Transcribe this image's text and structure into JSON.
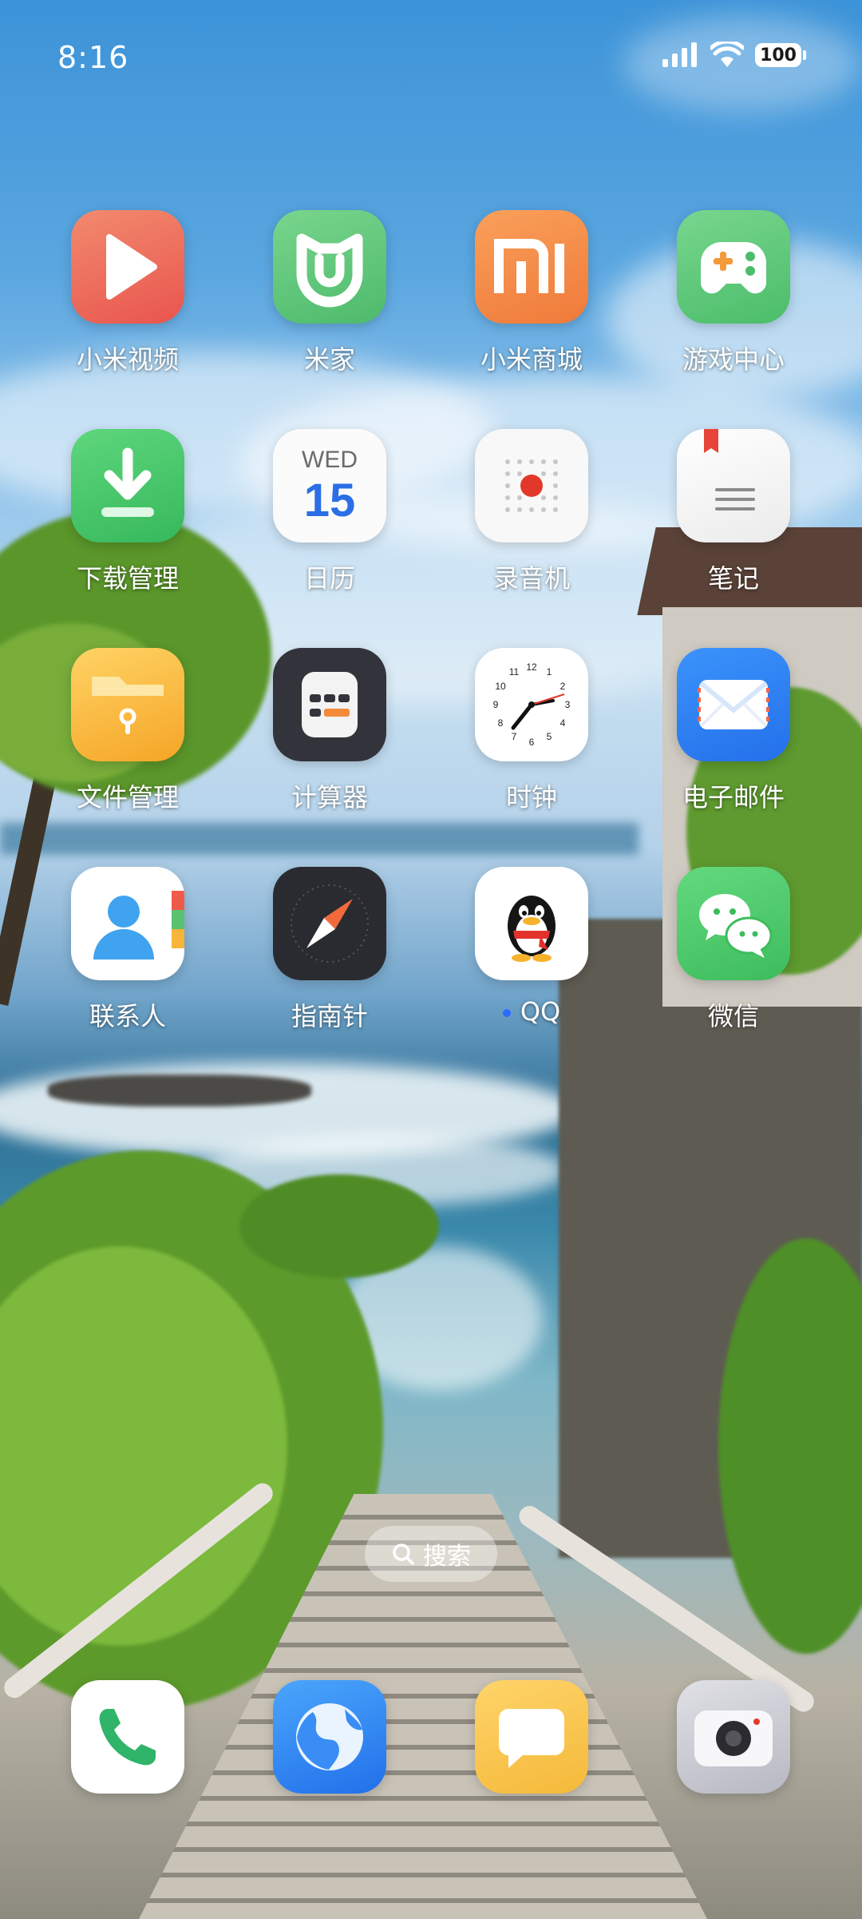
{
  "status_bar": {
    "time": "8:16",
    "battery": "100",
    "icons": [
      "signal-icon",
      "wifi-icon",
      "battery-icon"
    ]
  },
  "apps": [
    {
      "label": "小米视频",
      "icon": "play-icon"
    },
    {
      "label": "米家",
      "icon": "mijia-icon"
    },
    {
      "label": "小米商城",
      "icon": "mi-store-icon"
    },
    {
      "label": "游戏中心",
      "icon": "gamepad-icon"
    },
    {
      "label": "下载管理",
      "icon": "download-icon"
    },
    {
      "label": "日历",
      "icon": "calendar-icon",
      "day": "WED",
      "date": "15"
    },
    {
      "label": "录音机",
      "icon": "recorder-icon"
    },
    {
      "label": "笔记",
      "icon": "notes-icon"
    },
    {
      "label": "文件管理",
      "icon": "folder-icon"
    },
    {
      "label": "计算器",
      "icon": "calculator-icon"
    },
    {
      "label": "时钟",
      "icon": "clock-icon"
    },
    {
      "label": "电子邮件",
      "icon": "mail-icon"
    },
    {
      "label": "联系人",
      "icon": "contacts-icon"
    },
    {
      "label": "指南针",
      "icon": "compass-icon"
    },
    {
      "label": "QQ",
      "icon": "qq-penguin-icon",
      "new_install_dot": true
    },
    {
      "label": "微信",
      "icon": "wechat-icon"
    }
  ],
  "search": {
    "label": "搜索",
    "icon": "search-icon"
  },
  "dock": [
    {
      "name": "phone",
      "icon": "phone-icon"
    },
    {
      "name": "browser",
      "icon": "browser-icon"
    },
    {
      "name": "messages",
      "icon": "message-icon"
    },
    {
      "name": "camera",
      "icon": "camera-icon"
    }
  ],
  "colors": {
    "video": "#ef6a5c",
    "mijia": "#5ec77a",
    "store": "#f58a4a",
    "game": "#5cc97a",
    "download": "#4cc86a",
    "calendar_date": "#2b6ee6",
    "recorder_dot": "#e2382b",
    "folder": "#f7b53a",
    "calculator": "#33343b",
    "mail": "#2f86f5",
    "compass": "#2a2b30",
    "wechat": "#4cc86a",
    "phone": "#2fb46a",
    "browser": "#2f7ff0",
    "messages": "#f5c24a",
    "camera": "#c9c9d0"
  }
}
